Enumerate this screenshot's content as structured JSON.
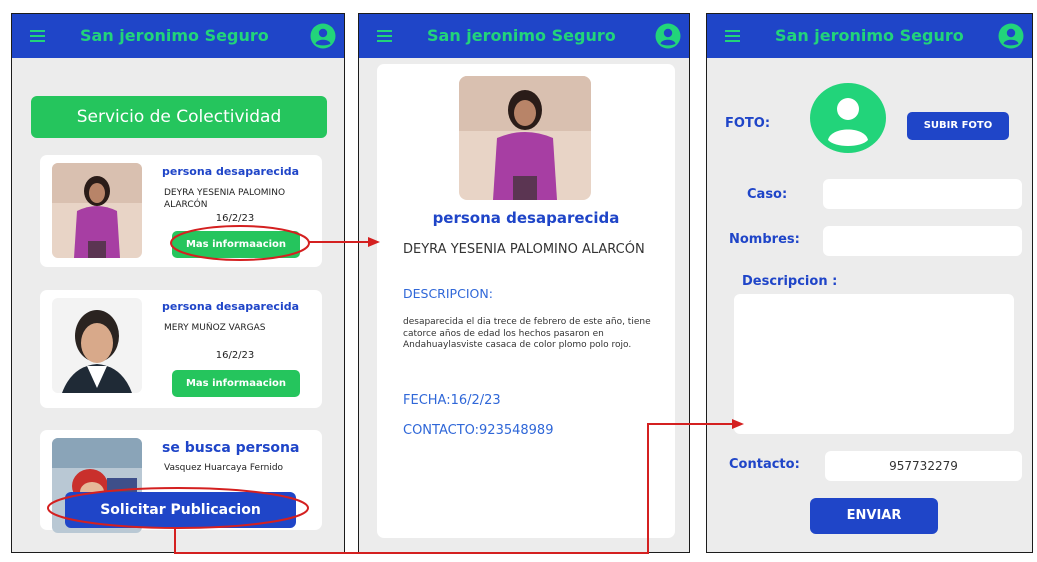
{
  "app": {
    "title": "San jeronimo Seguro"
  },
  "screen1": {
    "service_button": "Servicio de Colectividad",
    "cards": [
      {
        "title": "persona desaparecida",
        "name": "DEYRA YESENIA PALOMINO ALARCÓN",
        "date": "16/2/23",
        "button": "Mas informaacion"
      },
      {
        "title": "persona desaparecida",
        "name": "MERY MUÑOZ VARGAS",
        "date": "16/2/23",
        "button": "Mas informaacion"
      },
      {
        "title": "se busca persona",
        "name": "Vasquez Huarcaya Fernido"
      }
    ],
    "request_button": "Solicitar Publicacion"
  },
  "screen2": {
    "title": "persona desaparecida",
    "name": "DEYRA YESENIA PALOMINO ALARCÓN",
    "description_label": "DESCRIPCION:",
    "description": "desaparecida el dia trece de febrero de este año, tiene catorce años de edad los hechos pasaron en Andahuaylasviste casaca de color plomo polo rojo.",
    "date": "FECHA:16/2/23",
    "contact": "CONTACTO:923548989"
  },
  "screen3": {
    "photo_label": "FOTO:",
    "upload_button": "SUBIR FOTO",
    "case_label": "Caso:",
    "names_label": "Nombres:",
    "description_label": "Descripcion :",
    "contact_label": "Contacto:",
    "contact_value": "957732279",
    "send_button": "ENVIAR"
  },
  "colors": {
    "appbar": "#1f45c8",
    "accent_green": "#22d47a",
    "button_green": "#25c55d",
    "annotation_red": "#d42020"
  },
  "icons": [
    "menu-icon",
    "account-icon",
    "avatar-icon"
  ]
}
